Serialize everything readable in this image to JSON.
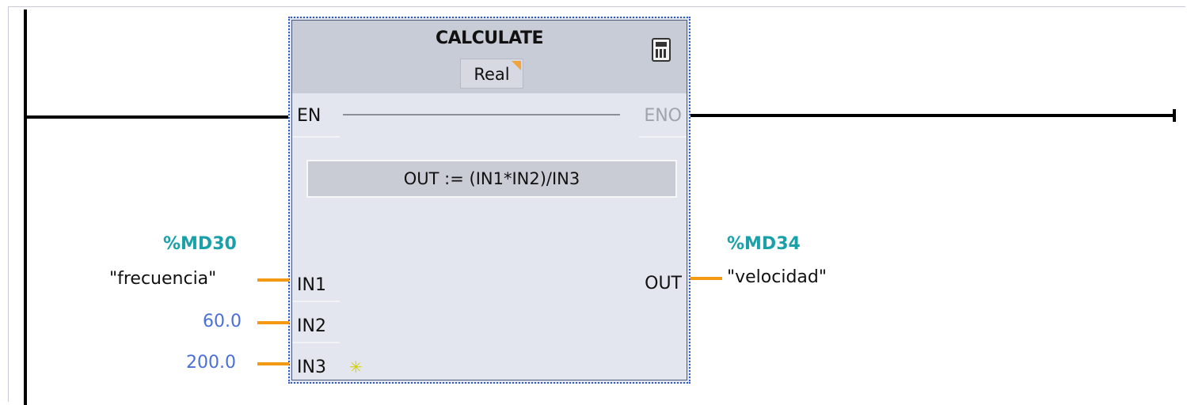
{
  "block": {
    "name": "CALCULATE",
    "data_type": "Real",
    "expression": "OUT :=   (IN1*IN2)/IN3",
    "icon": "calculator-icon"
  },
  "pins": {
    "en": "EN",
    "eno": "ENO",
    "in1": "IN1",
    "in2": "IN2",
    "in3": "IN3",
    "out": "OUT"
  },
  "operands": {
    "in1": {
      "address": "%MD30",
      "tag": "\"frecuencia\""
    },
    "in2": {
      "value": "60.0"
    },
    "in3": {
      "value": "200.0"
    },
    "out": {
      "address": "%MD34",
      "tag": "\"velocidad\""
    }
  },
  "colors": {
    "connection": "#f39a12",
    "address": "#1aa0a8",
    "constant": "#4a6fd8",
    "selection_border": "#2f5cc4"
  }
}
